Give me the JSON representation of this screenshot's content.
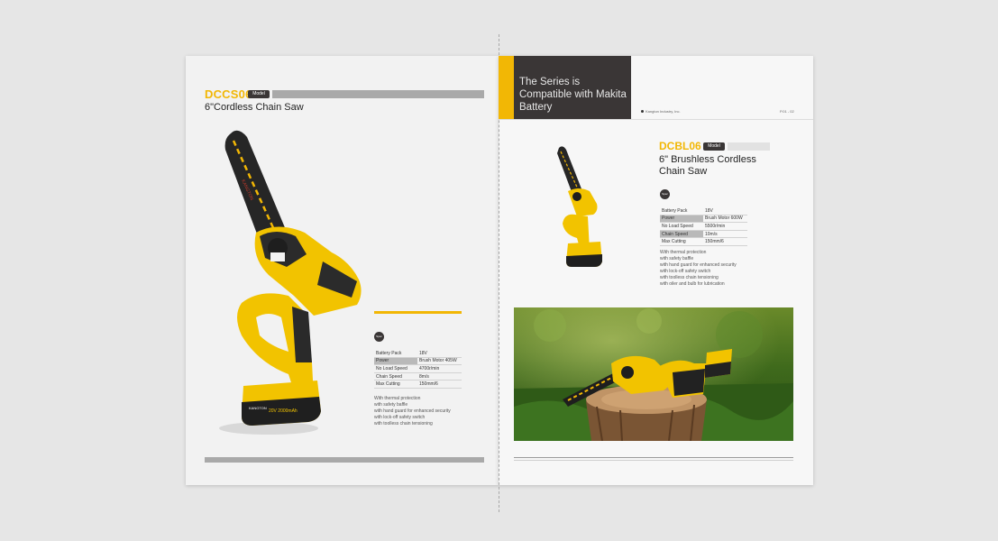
{
  "left_page": {
    "model_code": "DCCS06",
    "model_badge": "Model",
    "title": "6\"Cordless Chain Saw",
    "spec_badge": "Spec",
    "specs": [
      {
        "label": "Battery Pack",
        "value": "18V"
      },
      {
        "label": "Power",
        "value": "Brush Motor 405W"
      },
      {
        "label": "No Load Speed",
        "value": "4700r/min"
      },
      {
        "label": "Chain Speed",
        "value": "8m/s"
      },
      {
        "label": "Max Cutting",
        "value": "150mm/6"
      }
    ],
    "features": [
      "With thermal protection",
      "with safety baffle",
      "with hand guard for enhanced security",
      "with lock-off safety switch",
      "with toolless chain tensioning"
    ],
    "battery_label": "20V 2000mAh",
    "brand_mark": "KANGTON"
  },
  "right_page": {
    "header_text": "The Series is Compatible with Makita Battery",
    "company": "Kangton Industry, Inc.",
    "page_number": "P.01 - 02",
    "model_code": "DCBL06",
    "model_badge": "Model",
    "title": "6\" Brushless Cordless Chain Saw",
    "spec_badge": "Spec",
    "specs": [
      {
        "label": "Battery Pack",
        "value": "18V"
      },
      {
        "label": "Power",
        "value": "Brush Motor 600W"
      },
      {
        "label": "No Load Speed",
        "value": "5500r/min"
      },
      {
        "label": "Chain Speed",
        "value": "10m/s"
      },
      {
        "label": "Max Cutting",
        "value": "150mm/6"
      }
    ],
    "features": [
      "With thermal protection",
      "with safety baffle",
      "with hand guard for enhanced security",
      "with lock-off safety switch",
      "with toolless chain tensioning",
      "with oiler and bulb for lubrication"
    ]
  },
  "colors": {
    "accent_yellow": "#f2b705",
    "dark": "#3a3636",
    "bar_grey": "#a9a9a9"
  }
}
